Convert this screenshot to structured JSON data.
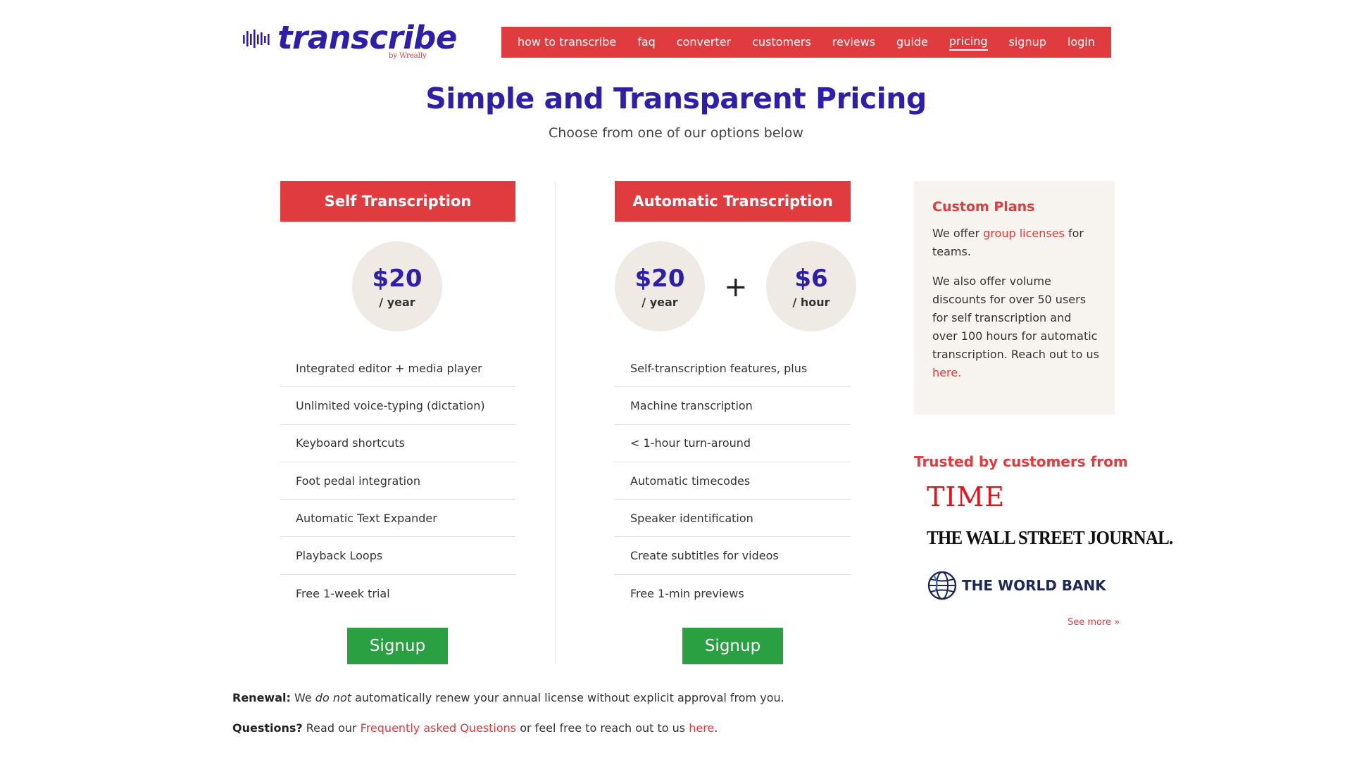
{
  "brand": {
    "name": "transcribe",
    "byline": "by Wreally",
    "accent_color": "#e03b3f",
    "primary_color": "#2e1fa8",
    "cta_color": "#2aa043"
  },
  "nav": {
    "items": [
      {
        "label": "how to transcribe"
      },
      {
        "label": "faq"
      },
      {
        "label": "converter"
      },
      {
        "label": "customers"
      },
      {
        "label": "reviews"
      },
      {
        "label": "guide"
      },
      {
        "label": "pricing",
        "active": true
      },
      {
        "label": "signup"
      },
      {
        "label": "login"
      }
    ]
  },
  "hero": {
    "title": "Simple and Transparent Pricing",
    "subtitle": "Choose from one of our options below"
  },
  "plans": {
    "self": {
      "name": "Self Transcription",
      "price_amount": "$20",
      "price_unit": "/ year",
      "features": [
        "Integrated editor + media player",
        "Unlimited voice-typing (dictation)",
        "Keyboard shortcuts",
        "Foot pedal integration",
        "Automatic Text Expander",
        "Playback Loops",
        "Free 1-week trial"
      ],
      "cta": "Signup"
    },
    "auto": {
      "name": "Automatic Transcription",
      "price_amount": "$20",
      "price_unit": "/ year",
      "plus": "+",
      "price2_amount": "$6",
      "price2_unit": "/ hour",
      "features": [
        "Self-transcription features, plus",
        "Machine transcription",
        "< 1-hour turn-around",
        "Automatic timecodes",
        "Speaker identification",
        "Create subtitles for videos",
        "Free 1-min previews"
      ],
      "cta": "Signup"
    }
  },
  "custom_plans": {
    "title": "Custom Plans",
    "p1_before": "We offer ",
    "p1_link": "group licenses",
    "p1_after": " for teams.",
    "p2_text": "We also offer volume discounts for over 50 users for self transcription and over 100 hours for automatic transcription. Reach out to us ",
    "p2_link": "here",
    "p2_end": "."
  },
  "trusted": {
    "title": "Trusted by customers from",
    "logos": [
      "TIME",
      "THE WALL STREET JOURNAL.",
      "THE WORLD BANK"
    ],
    "see_more": "See more »"
  },
  "footer": {
    "renewal_label": "Renewal:",
    "renewal_pre": " We ",
    "renewal_em": "do not",
    "renewal_post": " automatically renew your annual license without explicit approval from you.",
    "questions_label": "Questions?",
    "questions_pre": " Read our ",
    "questions_link": "Frequently asked Questions",
    "questions_mid": " or feel free to reach out to us ",
    "questions_link2": "here",
    "questions_end": "."
  }
}
